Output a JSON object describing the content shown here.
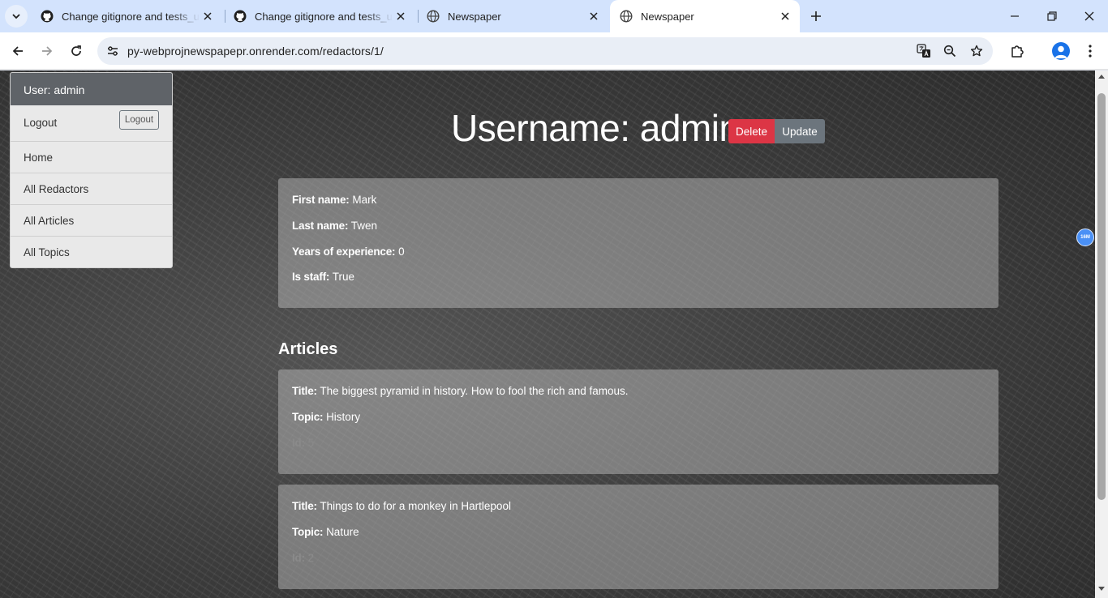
{
  "browser": {
    "tabs": [
      {
        "title": "Change gitignore and tests_util",
        "icon": "github-icon"
      },
      {
        "title": "Change gitignore and tests_util",
        "icon": "github-icon"
      },
      {
        "title": "Newspaper",
        "icon": "globe-icon"
      },
      {
        "title": "Newspaper",
        "icon": "globe-icon",
        "active": true
      }
    ],
    "url": "py-webprojnewspapepr.onrender.com/redactors/1/",
    "extension_badge": "16M"
  },
  "sidebar": {
    "user": "User: admin",
    "logout_label": "Logout",
    "logout_button": "Logout",
    "items": [
      {
        "label": "Home"
      },
      {
        "label": "All Redactors"
      },
      {
        "label": "All Articles"
      },
      {
        "label": "All Topics"
      }
    ]
  },
  "header": {
    "title": "Username: admin",
    "delete_label": "Delete",
    "update_label": "Update"
  },
  "profile": {
    "first_name_label": "First name:",
    "first_name": "Mark",
    "last_name_label": "Last name:",
    "last_name": "Twen",
    "experience_label": "Years of experience:",
    "experience": "0",
    "staff_label": "Is staff:",
    "staff": "True"
  },
  "articles": {
    "heading": "Articles",
    "title_label": "Title:",
    "topic_label": "Topic:",
    "id_label": "Id:",
    "items": [
      {
        "title": "The biggest pyramid in history. How to fool the rich and famous.",
        "topic": "History",
        "id": "5"
      },
      {
        "title": "Things to do for a monkey in Hartlepool",
        "topic": "Nature",
        "id": "2"
      }
    ]
  },
  "colors": {
    "tab_strip": "#d3e3fd",
    "delete": "#dc3545",
    "update": "#6c757d",
    "sidebar_header": "#5f6368"
  }
}
